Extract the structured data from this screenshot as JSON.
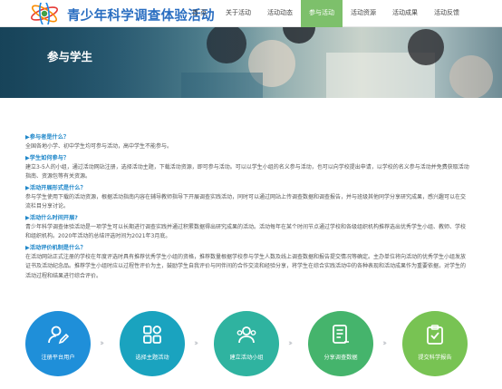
{
  "header": {
    "site_title": "青少年科学调查体验活动",
    "nav": [
      {
        "label": "首 页",
        "active": false
      },
      {
        "label": "关于活动",
        "active": false
      },
      {
        "label": "活动动态",
        "active": false
      },
      {
        "label": "参与活动",
        "active": true
      },
      {
        "label": "活动资源",
        "active": false
      },
      {
        "label": "活动成果",
        "active": false
      },
      {
        "label": "活动反馈",
        "active": false
      }
    ]
  },
  "banner": {
    "title": "参与学生"
  },
  "faq": [
    {
      "q": "▶参与者是什么？",
      "a": "全国各地小学、初中学生均可参与活动，高中学生不能参与。"
    },
    {
      "q": "▶学生如何参与？",
      "a": "建立3-5人的小组，通过活动网站注册，选择活动主题，下载活动资源，即可参与活动。可以以学生小组的名义参与活动，也可以向学校提出申请，以学校的名义参与活动并免费获取活动指南、资源包等有关资源。"
    },
    {
      "q": "▶活动开展形式是什么？",
      "a": "参与学生使用下载的活动资源，根据活动指南内容在辅导教师指导下开展调查实践活动，同时可以通过网站上传调查数据和调查报告，并与班级其他同学分享研究成果，感兴趣可以在交流栏目分享讨论。"
    },
    {
      "q": "▶活动什么时间开展?",
      "a": "青少年科学调查体验活动是一项学生可以长期进行调查实践并通过积累数据得出研究成果的活动。活动每年在某个时间节点通过学校和各级组织机构推荐选出优秀学生小组、教师、学校和组织机构。2020年活动的总结评选时间为2021年3月底。"
    },
    {
      "q": "▶活动评价机制是什么？",
      "a": "在活动网站正式注册的学校在年度评选时具有推荐优秀学生小组的资格，推荐数量根据学校参与学生人数及线上调查数据和报告提交情况等确定。主办单位将向活动的优秀学生小组发放证书及活动纪念品。推荐学生小组时应以过程性评价为主，鼓励学生自我评价与同伴间的合作交流和经验分享，将学生在综合实践活动中的各种表现和活动成果作为重要依据，对学生的活动过程和结果进行综合评价。"
    }
  ],
  "steps": [
    {
      "label": "注册平台用户",
      "icon": "user-edit-icon",
      "color": "#1f8fd9"
    },
    {
      "label": "选择主题活动",
      "icon": "grid-icon",
      "color": "#1aa3bf"
    },
    {
      "label": "建立活动小组",
      "icon": "group-icon",
      "color": "#2fb3a0"
    },
    {
      "label": "分享调查数据",
      "icon": "document-icon",
      "color": "#45b46c"
    },
    {
      "label": "提交科学报告",
      "icon": "clipboard-check-icon",
      "color": "#78c353"
    }
  ],
  "colors": {
    "accent": "#7dc06b",
    "link": "#1d86c9",
    "title": "#2a6ec1"
  }
}
